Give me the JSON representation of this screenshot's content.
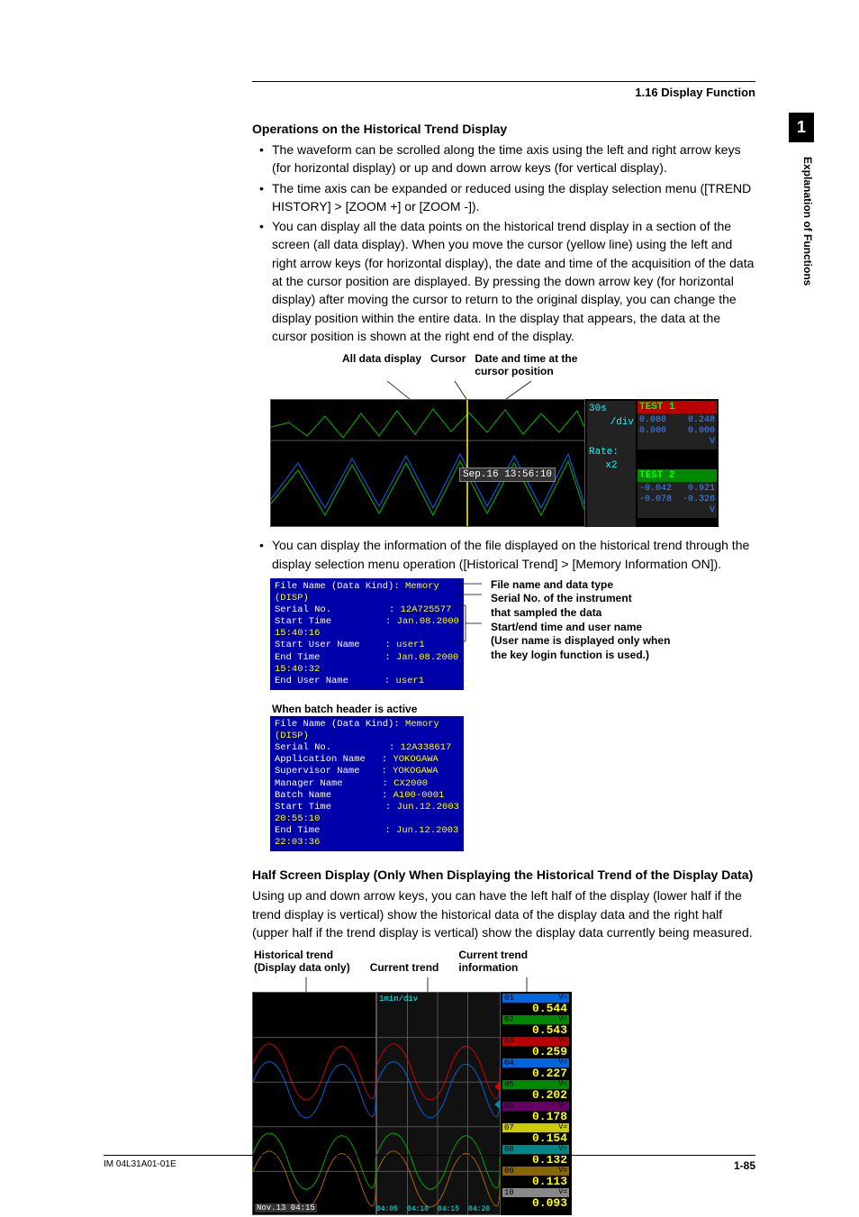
{
  "header": {
    "section": "1.16  Display Function"
  },
  "chapter": {
    "number": "1",
    "title": "Explanation of Functions"
  },
  "sec1": {
    "title": "Operations on the Historical Trend Display",
    "bullets": [
      "The waveform can be scrolled along the time axis using the left and right arrow keys (for horizontal display) or up and down arrow keys (for vertical display).",
      "The time axis can be expanded or reduced using the display selection menu ([TREND HISTORY] > [ZOOM +] or [ZOOM -]).",
      "You can display all the data points on the historical trend display in a section of the screen (all data display).  When you move the cursor (yellow line) using the left and right arrow keys (for horizontal display), the date and time of the acquisition of the data at the cursor position are displayed.  By pressing the down arrow key (for horizontal display) after moving the cursor to return to the original display, you can change the display position within the entire data.  In the display that appears, the data at the cursor position is shown at the right end of the display."
    ],
    "fig_labels": {
      "l1": "All data display",
      "l2": "Cursor",
      "l3a": "Date and time at the",
      "l3b": "cursor position"
    },
    "bullet4": "You can display the information of the file displayed on the historical trend through the display selection menu operation ([Historical Trend] > [Memory Information ON])."
  },
  "shot1": {
    "rate": {
      "l1": "30s",
      "l2": "/div",
      "l3": "Rate:",
      "l4": "x2"
    },
    "cursor_time": "Sep.16 13:56:10",
    "test1": {
      "title": "TEST 1",
      "v1": "0.080",
      "v2": "0.000",
      "r1": "0.248",
      "r2": "0.000",
      "unit": "V"
    },
    "test2": {
      "title": "TEST 2",
      "v1": "-0.042",
      "v2": "-0.078",
      "r1": "0.921",
      "r2": "-0.326",
      "unit": "V"
    }
  },
  "info": {
    "labels": [
      "File name and data type",
      "Serial No. of the instrument",
      "that sampled the data",
      "Start/end time and user name",
      "(User name is displayed only when",
      "the key login function is used.)"
    ],
    "box1": {
      "r1k": "File Name (Data Kind)",
      "r1v": "Memory (DISP)",
      "r2k": "Serial No.",
      "r2v": "12A725577",
      "r3k": "Start Time",
      "r3v": "Jan.08.2000 15:40:16",
      "r4k": "Start User Name",
      "r4v": "user1",
      "r5k": "End Time",
      "r5v": "Jan.08.2000 15:40:32",
      "r6k": "End User Name",
      "r6v": "user1"
    },
    "batch_hdr": "When batch header is active",
    "box2": {
      "r1k": "File Name (Data Kind)",
      "r1v": "Memory (DISP)",
      "r2k": "Serial No.",
      "r2v": "12A338617",
      "r3k": "Application Name",
      "r3v": "YOKOGAWA",
      "r4k": "Supervisor Name",
      "r4v": "YOKOGAWA",
      "r5k": "Manager Name",
      "r5v": "CX2000",
      "r6k": "Batch Name",
      "r6v": "A100-0001",
      "r7k": "Start Time",
      "r7v": "Jun.12.2003 20:55:10",
      "r8k": "End Time",
      "r8v": "Jun.12.2003 22:03:36"
    }
  },
  "sec2": {
    "title": "Half Screen Display (Only When Displaying the Historical Trend of the Display Data)",
    "body": "Using up and down arrow keys, you can have the left half of the display (lower half if the trend display is vertical) show the historical data of the display data and the right half (upper half if the trend display is vertical) show the display data currently being measured.",
    "fig_labels": {
      "l1a": "Historical trend",
      "l1b": "(Display data only)",
      "l2": "Current trend",
      "l3a": "Current trend",
      "l3b": "information"
    }
  },
  "shot2": {
    "axis": "1min/div",
    "timestamp": "Nov.13 04:15",
    "xticks": [
      "04:05",
      "04:10",
      "04:15",
      "04:20"
    ],
    "channels": [
      {
        "id": "01",
        "unit": "V=",
        "val": "0.544",
        "bg": "#0066dd"
      },
      {
        "id": "02",
        "unit": "V=",
        "val": "0.543",
        "bg": "#008800"
      },
      {
        "id": "03",
        "unit": "V=",
        "val": "0.259",
        "bg": "#bb0000"
      },
      {
        "id": "04",
        "unit": "V=",
        "val": "0.227",
        "bg": "#0066dd"
      },
      {
        "id": "05",
        "unit": "V=",
        "val": "0.202",
        "bg": "#008800"
      },
      {
        "id": "06",
        "unit": "V=",
        "val": "0.178",
        "bg": "#660066"
      },
      {
        "id": "07",
        "unit": "V=",
        "val": "0.154",
        "bg": "#cccc00"
      },
      {
        "id": "08",
        "unit": "V=",
        "val": "0.132",
        "bg": "#008888"
      },
      {
        "id": "09",
        "unit": "V=",
        "val": "0.113",
        "bg": "#886600"
      },
      {
        "id": "10",
        "unit": "V=",
        "val": "0.093",
        "bg": "#888888"
      }
    ]
  },
  "footer": {
    "left": "IM 04L31A01-01E",
    "right": "1-85"
  }
}
